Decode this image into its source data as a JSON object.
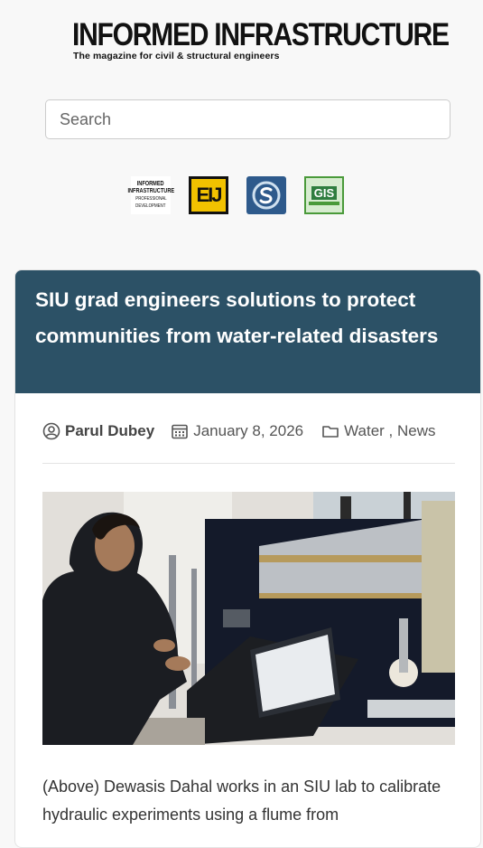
{
  "masthead": {
    "title": "INFORMED INFRASTRUCTURE",
    "tagline": "The magazine for civil & structural engineers"
  },
  "search": {
    "placeholder": "Search",
    "value": ""
  },
  "logos": [
    {
      "name": "informed-infrastructure-professional-development",
      "lines": [
        "INFORMED",
        "INFRASTRUCTURE",
        "PROFESSIONAL",
        "DEVELOPMENT"
      ]
    },
    {
      "name": "eij",
      "text": "EIJ"
    },
    {
      "name": "s-logo",
      "text": "S"
    },
    {
      "name": "gis",
      "text": "GIS"
    }
  ],
  "article": {
    "title": "SIU grad engineers solutions to protect communities from water-related disasters",
    "author": "Parul Dubey",
    "date": "January 8, 2026",
    "categories": "Water , News",
    "caption": "(Above) Dewasis Dahal works in an SIU lab to calibrate hydraulic experiments using a flume from"
  },
  "colors": {
    "header_bg": "#2c5166",
    "page_bg": "#f8f8f8",
    "eij_yellow": "#f2c200",
    "s_blue": "#2e5a8c",
    "gis_green": "#2f7d3f"
  }
}
